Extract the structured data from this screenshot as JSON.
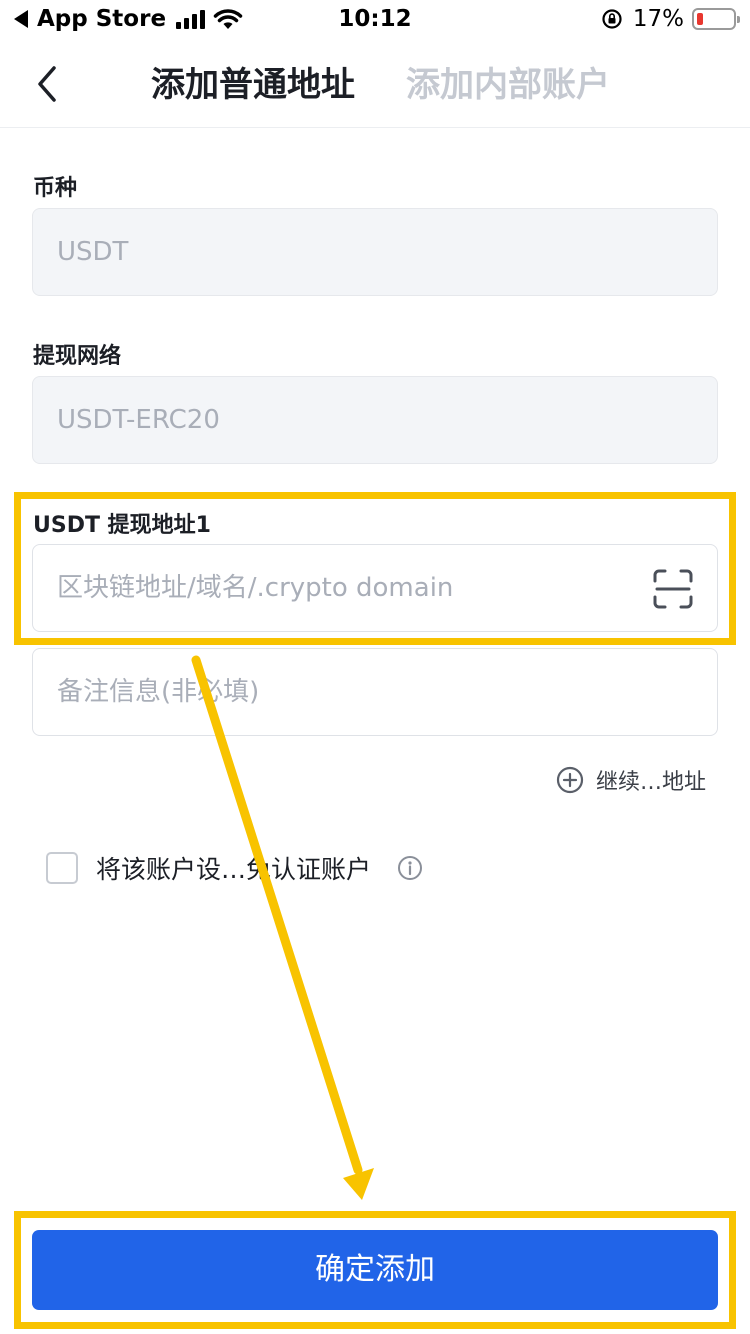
{
  "status_bar": {
    "back_app": "App Store",
    "time": "10:12",
    "battery": "17%"
  },
  "nav": {
    "tab_active": "添加普通地址",
    "tab_inactive": "添加内部账户"
  },
  "form": {
    "currency_label": "币种",
    "currency_value": "USDT",
    "network_label": "提现网络",
    "network_value": "USDT-ERC20",
    "address_label": "USDT 提现地址1",
    "address_placeholder": "区块链地址/域名/.crypto domain",
    "memo_placeholder": "备注信息(非必填)",
    "add_more": "继续…地址",
    "checkbox_label": "将该账户设…免认证账户"
  },
  "confirm_button": "确定添加",
  "colors": {
    "accent": "#2164e8",
    "highlight": "#f8c300",
    "battery_low": "#e8372f"
  }
}
